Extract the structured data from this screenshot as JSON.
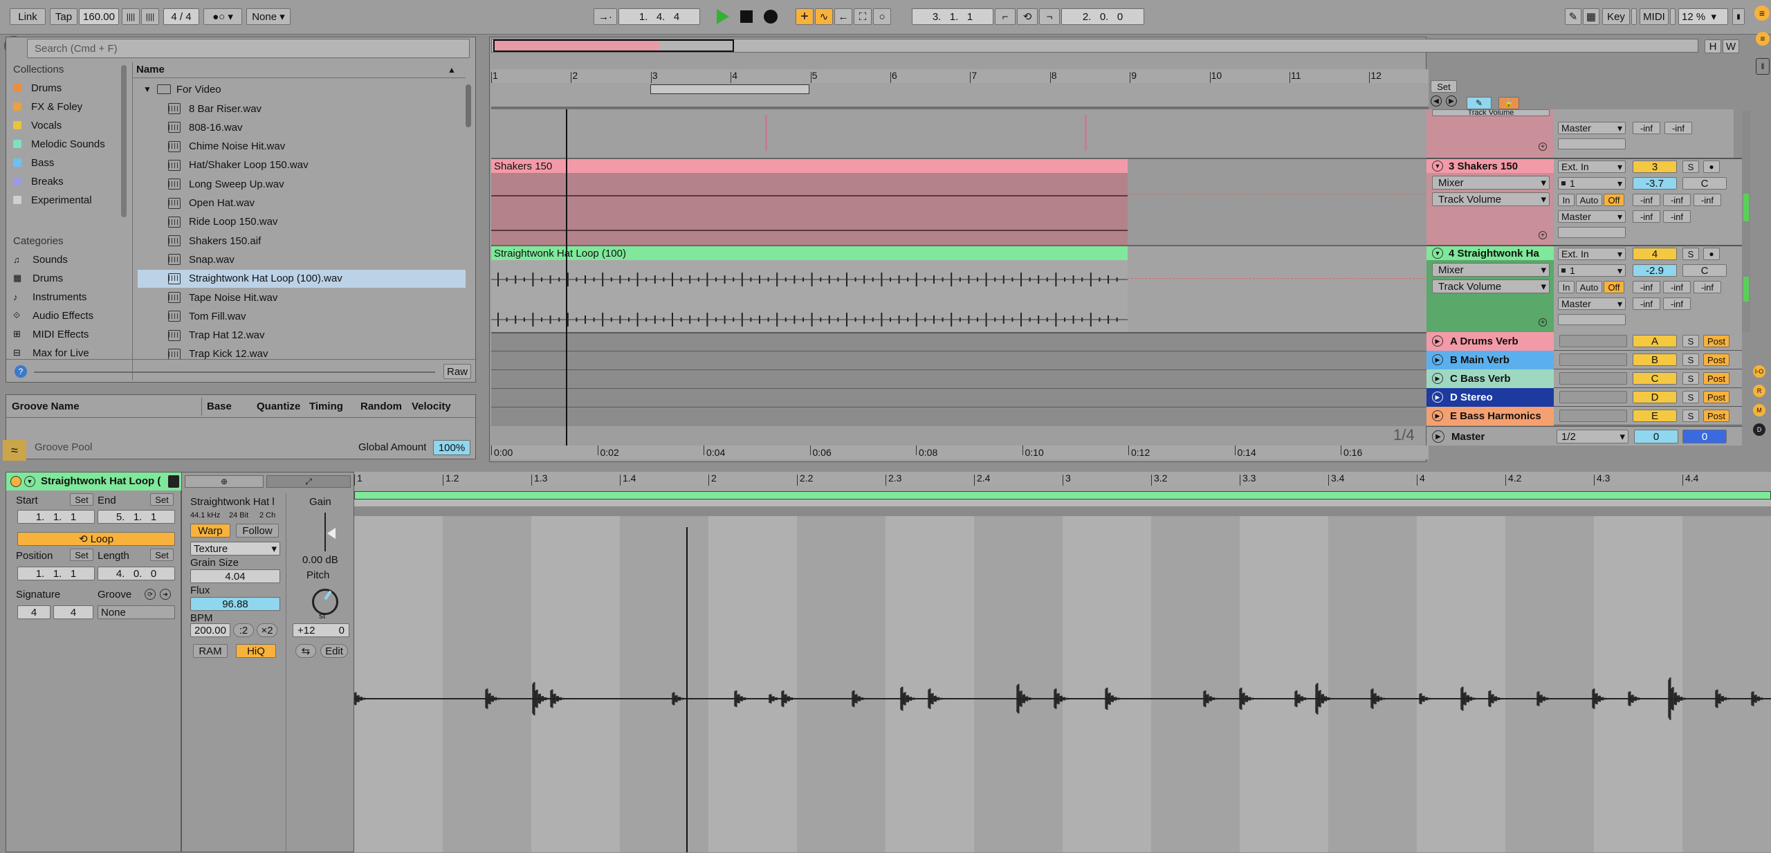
{
  "transport": {
    "link": "Link",
    "tap": "Tap",
    "bpm": "160.00",
    "signature": "4 / 4",
    "quant": "None",
    "position": "1.   4.   4",
    "loop_start": "3.   1.   1",
    "loop_length": "2.   0.   0",
    "key": "Key",
    "midi": "MIDI",
    "cpu": "12 %"
  },
  "browser": {
    "search_placeholder": "Search (Cmd + F)",
    "collections_header": "Collections",
    "collections": [
      {
        "label": "Drums",
        "color": "#e8903e"
      },
      {
        "label": "FX & Foley",
        "color": "#e8a23e"
      },
      {
        "label": "Vocals",
        "color": "#eac43a"
      },
      {
        "label": "Melodic Sounds",
        "color": "#7fe0c0"
      },
      {
        "label": "Bass",
        "color": "#6ec0f0"
      },
      {
        "label": "Breaks",
        "color": "#9a9ae6"
      },
      {
        "label": "Experimental",
        "color": "#cfcfcf"
      }
    ],
    "categories_header": "Categories",
    "categories": [
      "Sounds",
      "Drums",
      "Instruments",
      "Audio Effects",
      "MIDI Effects",
      "Max for Live"
    ],
    "name_header": "Name",
    "folder": "For Video",
    "files": [
      "8 Bar Riser.wav",
      "808-16.wav",
      "Chime Noise Hit.wav",
      "Hat/Shaker Loop 150.wav",
      "Long Sweep Up.wav",
      "Open Hat.wav",
      "Ride Loop 150.wav",
      "Shakers 150.aif",
      "Snap.wav",
      "Straightwonk Hat Loop (100).wav",
      "Tape Noise Hit.wav",
      "Tom Fill.wav",
      "Trap Hat 12.wav",
      "Trap Kick 12.wav"
    ],
    "raw": "Raw"
  },
  "groove": {
    "col_name": "Groove Name",
    "col_base": "Base",
    "col_quantize": "Quantize",
    "col_timing": "Timing",
    "col_random": "Random",
    "col_velocity": "Velocity",
    "pool": "Groove Pool",
    "global_amount_label": "Global Amount",
    "global_amount": "100%"
  },
  "arrangement": {
    "ruler": [
      "1",
      "2",
      "3",
      "4",
      "5",
      "6",
      "7",
      "8",
      "9",
      "10",
      "11",
      "12"
    ],
    "times": [
      "0:00",
      "0:02",
      "0:04",
      "0:06",
      "0:08",
      "0:10",
      "0:12",
      "0:14",
      "0:16"
    ],
    "page": "1/4",
    "set": "Set",
    "h": "H",
    "w": "W",
    "clip1": "Shakers 150",
    "clip2": "Straightwonk Hat Loop (100)"
  },
  "tracks": [
    {
      "name": "3 Shakers 150",
      "input": "Ext. In",
      "mixer": "Mixer",
      "channel": "1",
      "auto": "Track Volume",
      "output": "Master",
      "number": "3",
      "volume": "-3.7",
      "pan": "C",
      "color": "#f39aa8"
    },
    {
      "name": "4 Straightwonk Ha",
      "input": "Ext. In",
      "mixer": "Mixer",
      "channel": "1",
      "auto": "Track Volume",
      "output": "Master",
      "number": "4",
      "volume": "-2.9",
      "pan": "C",
      "color": "#7fe89a"
    }
  ],
  "track_top": {
    "auto": "Track Volume",
    "output": "Master"
  },
  "returns": [
    {
      "name": "A Drums Verb",
      "letter": "A",
      "color": "#f39aa8"
    },
    {
      "name": "B Main Verb",
      "letter": "B",
      "color": "#5ab0ee"
    },
    {
      "name": "C Bass Verb",
      "letter": "C",
      "color": "#9fd8c0"
    },
    {
      "name": "D Stereo",
      "letter": "D",
      "color": "#1c3aa0"
    },
    {
      "name": "E Bass Harmonics",
      "letter": "E",
      "color": "#f5a070"
    }
  ],
  "master": {
    "name": "Master",
    "cue": "1/2",
    "volume": "0",
    "pan": "0"
  },
  "mix_labels": {
    "in": "In",
    "auto": "Auto",
    "off": "Off",
    "inf": "-inf",
    "s": "S",
    "post": "Post"
  },
  "clip": {
    "title": "Straightwonk Hat Loop (",
    "start_label": "Start",
    "end_label": "End",
    "set": "Set",
    "start": "1.   1.   1",
    "end": "5.   1.   1",
    "loop": "Loop",
    "position_label": "Position",
    "length_label": "Length",
    "position": "1.   1.   1",
    "length": "4.   0.   0",
    "signature_label": "Signature",
    "groove_label": "Groove",
    "sig_num": "4",
    "sig_den": "4",
    "groove": "None"
  },
  "sample": {
    "name": "Straightwonk Hat l",
    "rate": "44.1 kHz",
    "bits": "24 Bit",
    "channels": "2 Ch",
    "warp": "Warp",
    "follow": "Follow",
    "mode": "Texture",
    "grain_label": "Grain Size",
    "grain": "4.04",
    "flux_label": "Flux",
    "flux": "96.88",
    "bpm_label": "BPM",
    "bpm": "200.00",
    "half": ":2",
    "double": "×2",
    "ram": "RAM",
    "hiq": "HiQ",
    "gain_label": "Gain",
    "gain": "0.00 dB",
    "pitch_label": "Pitch",
    "st": "st",
    "transpose": "+12",
    "detune": "0",
    "edit": "Edit"
  },
  "detail_ruler": [
    "1",
    "1.2",
    "1.3",
    "1.4",
    "2",
    "2.2",
    "2.3",
    "2.4",
    "3",
    "3.2",
    "3.3",
    "3.4",
    "4",
    "4.2",
    "4.3",
    "4.4"
  ],
  "colors": {
    "accent_orange": "#f8b23b",
    "clip_green": "#7fe89a",
    "clip_pink": "#f39aa8",
    "play_green": "#35b035"
  }
}
